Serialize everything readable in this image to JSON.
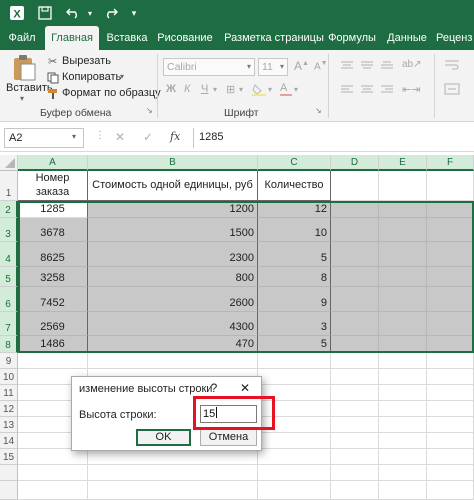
{
  "titlebar": {
    "excel_icon": "excel-logo-icon",
    "save_icon": "save-icon",
    "undo_icon": "undo-icon",
    "redo_icon": "redo-icon",
    "more_icon": "customize-quick-access-icon"
  },
  "ribbon_tabs": [
    "Файл",
    "Главная",
    "Вставка",
    "Рисование",
    "Разметка страницы",
    "Формулы",
    "Данные",
    "Реценз"
  ],
  "ribbon": {
    "paste_label": "Вставить",
    "cut_label": "Вырезать",
    "copy_label": "Копировать",
    "format_painter_label": "Формат по образцу",
    "clipboard_group": "Буфер обмена",
    "font_name": "Calibri",
    "font_size": "11",
    "font_group": "Шрифт"
  },
  "formula_bar": {
    "name_box": "A2",
    "fx": "fx",
    "cancel_icon": "close-icon",
    "enter_icon": "check-icon",
    "value": "1285"
  },
  "grid": {
    "columns": [
      "A",
      "B",
      "C",
      "D",
      "E",
      "F"
    ],
    "rows": [
      "1",
      "2",
      "3",
      "4",
      "5",
      "6",
      "7",
      "8",
      "9",
      "10",
      "11",
      "12",
      "13",
      "14",
      "15"
    ],
    "headers": [
      "Номер заказа",
      "Стоимость одной единицы, руб",
      "Количество"
    ],
    "data": [
      [
        "1285",
        "1200",
        "12"
      ],
      [
        "3678",
        "1500",
        "10"
      ],
      [
        "8625",
        "2300",
        "5"
      ],
      [
        "3258",
        "800",
        "8"
      ],
      [
        "7452",
        "2600",
        "9"
      ],
      [
        "2569",
        "4300",
        "3"
      ],
      [
        "1486",
        "470",
        "5"
      ]
    ]
  },
  "dialog": {
    "title": "изменение высоты строки",
    "help": "?",
    "close": "✕",
    "label": "Высота строки:",
    "value": "15",
    "ok": "OK",
    "cancel": "Отмена"
  },
  "colors": {
    "accent": "#1e6c41",
    "selection": "#c8c8c8",
    "highlight": "#e81123"
  }
}
